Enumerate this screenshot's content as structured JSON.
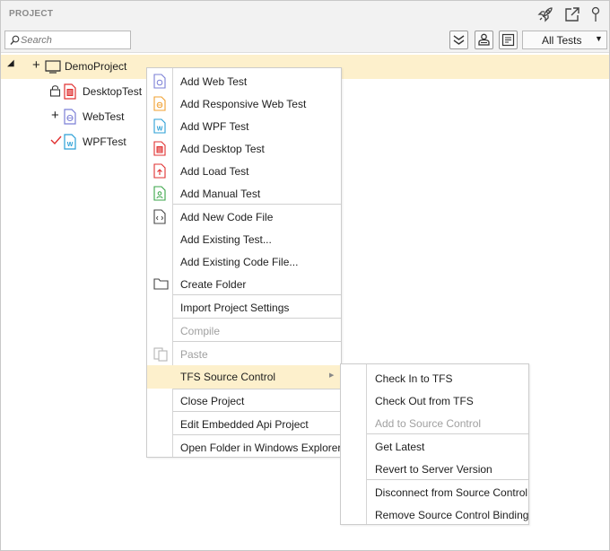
{
  "panel": {
    "title": "PROJECT"
  },
  "toolbar": {
    "search_placeholder": "Search",
    "filter_value": "All Tests",
    "filter_arrow": "▼"
  },
  "tree": {
    "root": {
      "label": "DemoProject",
      "expander": "◢",
      "status": "+"
    },
    "children": [
      {
        "label": "DesktopTest",
        "status": "lock",
        "icon": "desktop-test-icon"
      },
      {
        "label": "WebTest",
        "status": "+",
        "icon": "web-test-icon"
      },
      {
        "label": "WPFTest",
        "status": "check",
        "icon": "wpf-test-icon"
      }
    ]
  },
  "context_menu": {
    "items": [
      {
        "label": "Add Web Test",
        "icon": "web-test-icon",
        "enabled": true
      },
      {
        "label": "Add Responsive Web Test",
        "icon": "responsive-web-test-icon",
        "enabled": true
      },
      {
        "label": "Add WPF Test",
        "icon": "wpf-test-icon",
        "enabled": true
      },
      {
        "label": "Add Desktop Test",
        "icon": "desktop-test-icon",
        "enabled": true
      },
      {
        "label": "Add Load Test",
        "icon": "load-test-icon",
        "enabled": true
      },
      {
        "label": "Add Manual Test",
        "icon": "manual-test-icon",
        "enabled": true
      },
      {
        "label": "Add New Code File",
        "icon": "code-file-icon",
        "enabled": true
      },
      {
        "label": "Add Existing Test...",
        "enabled": true
      },
      {
        "label": "Add Existing Code File...",
        "enabled": true
      },
      {
        "label": "Create Folder",
        "icon": "folder-icon",
        "enabled": true
      },
      {
        "label": "Import Project Settings",
        "enabled": true
      },
      {
        "label": "Compile",
        "enabled": false
      },
      {
        "label": "Paste",
        "icon": "paste-icon",
        "enabled": false
      },
      {
        "label": "TFS Source Control",
        "enabled": true,
        "highlighted": true,
        "submenu_arrow": "▶"
      },
      {
        "label": "Close Project",
        "enabled": true
      },
      {
        "label": "Edit Embedded Api Project",
        "enabled": true
      },
      {
        "label": "Open Folder in Windows Explorer",
        "enabled": true
      }
    ]
  },
  "tfs_submenu": {
    "items": [
      {
        "label": "Check In to TFS",
        "enabled": true
      },
      {
        "label": "Check Out from TFS",
        "enabled": true
      },
      {
        "label": "Add to Source Control",
        "enabled": false
      },
      {
        "label": "Get Latest",
        "enabled": true
      },
      {
        "label": "Revert to Server Version",
        "enabled": true
      },
      {
        "label": "Disconnect from Source Control",
        "enabled": true
      },
      {
        "label": "Remove Source Control Binding",
        "enabled": true
      }
    ]
  },
  "colors": {
    "highlight": "#fdf0cc",
    "web_icon": "#7b7fd6",
    "responsive_icon": "#f0a030",
    "wpf_icon": "#2a9fd6",
    "desktop_icon": "#e03030",
    "manual_icon": "#3aa548",
    "check": "#e03030"
  }
}
